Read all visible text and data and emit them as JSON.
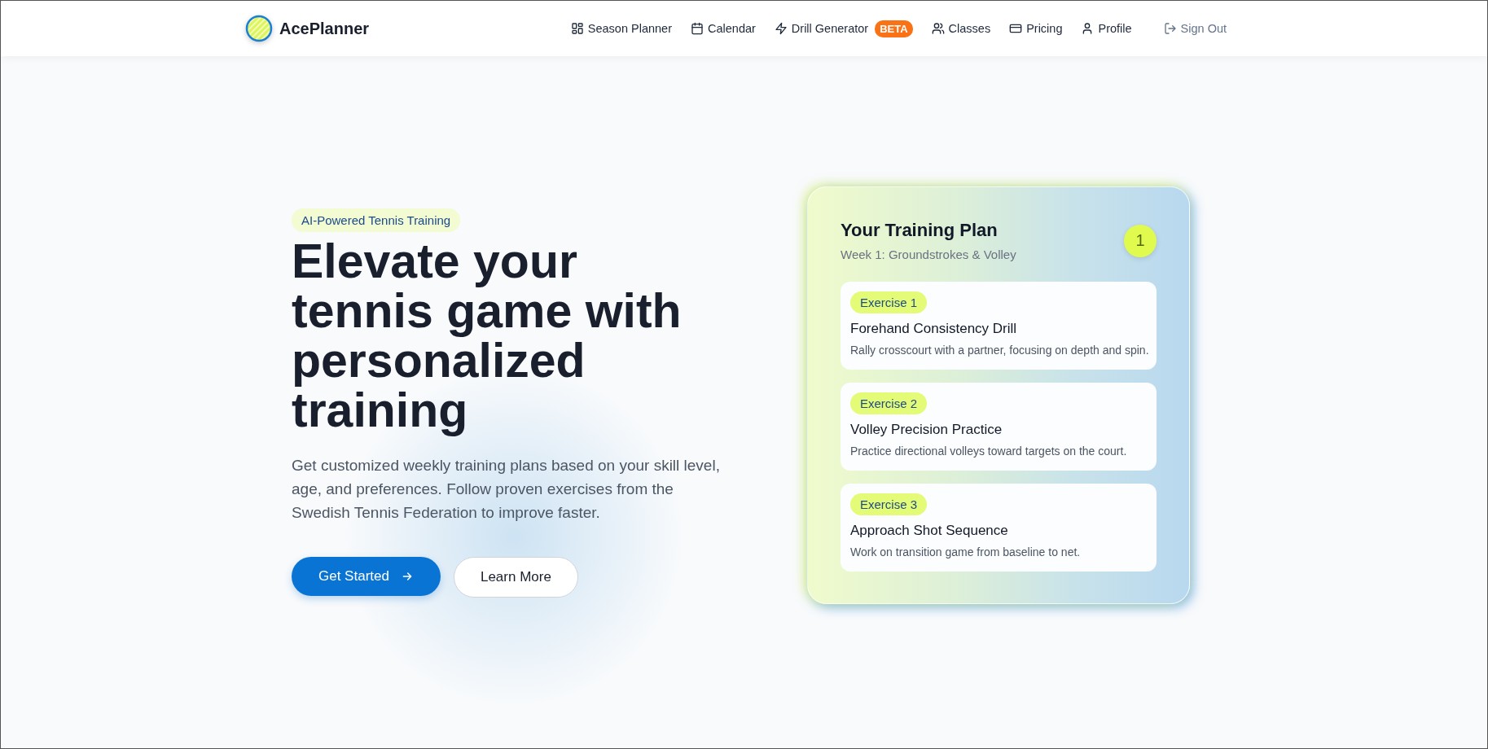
{
  "brand": {
    "name": "AcePlanner"
  },
  "nav": [
    {
      "label": "Season Planner",
      "kind": "link"
    },
    {
      "label": "Calendar",
      "kind": "link"
    },
    {
      "label": "Drill Generator",
      "kind": "link",
      "badge": "BETA"
    },
    {
      "label": "Classes",
      "kind": "link"
    },
    {
      "label": "Pricing",
      "kind": "link"
    },
    {
      "label": "Profile",
      "kind": "link"
    },
    {
      "label": "Sign Out",
      "kind": "signout"
    }
  ],
  "hero": {
    "tagline": "AI-Powered Tennis Training",
    "heading": "Elevate your tennis game with personalized training",
    "description": "Get customized weekly training plans based on your skill level, age, and preferences. Follow proven exercises from the Swedish Tennis Federation to improve faster.",
    "buttons": [
      {
        "label": "Get Started",
        "kind": "primary"
      },
      {
        "label": "Learn More",
        "kind": "secondary"
      }
    ]
  },
  "plan": {
    "title": "Your Training Plan",
    "subtitle": "Week 1: Groundstrokes & Volley",
    "week": "1",
    "exercises": [
      {
        "tag": "Exercise 1",
        "title": "Forehand Consistency Drill",
        "description": "Rally crosscourt with a partner, focusing on depth and spin."
      },
      {
        "tag": "Exercise 2",
        "title": "Volley Precision Practice",
        "description": "Practice directional volleys toward targets on the court."
      },
      {
        "tag": "Exercise 3",
        "title": "Approach Shot Sequence",
        "description": "Work on transition game from baseline to net."
      }
    ]
  }
}
